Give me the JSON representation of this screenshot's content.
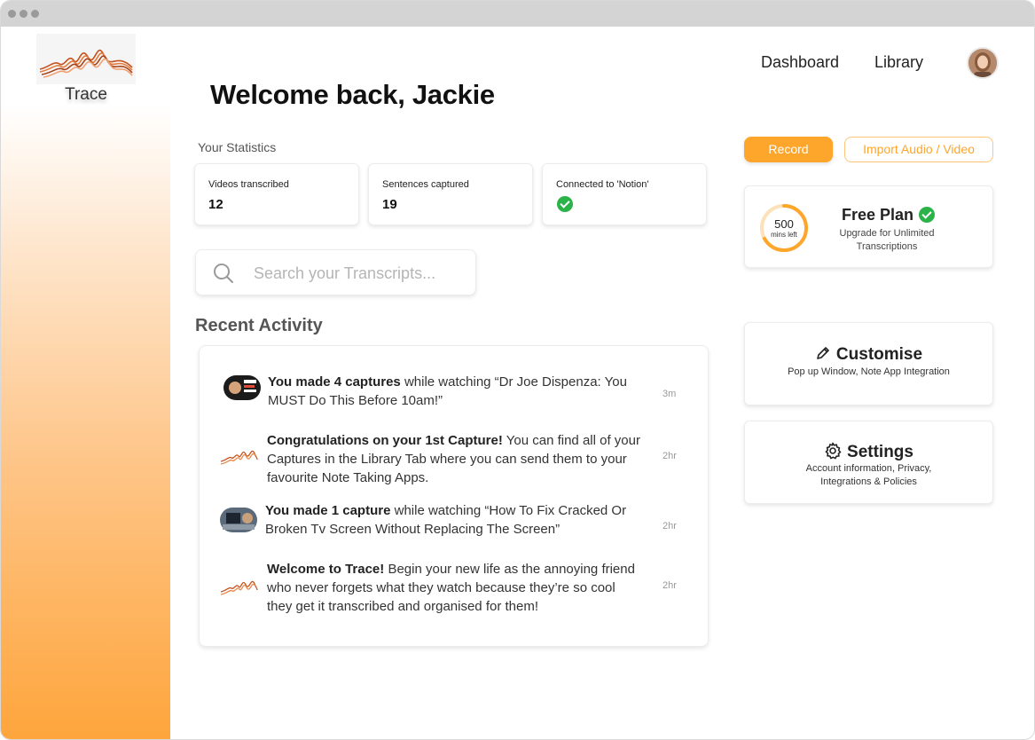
{
  "app": {
    "name": "Trace"
  },
  "nav": {
    "dashboard": "Dashboard",
    "library": "Library"
  },
  "header": {
    "welcome": "Welcome back, Jackie"
  },
  "statistics": {
    "label": "Your Statistics",
    "cards": [
      {
        "label": "Videos transcribed",
        "value": "12"
      },
      {
        "label": "Sentences captured",
        "value": "19"
      },
      {
        "label": "Connected to 'Notion'",
        "status": "connected"
      }
    ]
  },
  "search": {
    "placeholder": "Search your Transcripts..."
  },
  "recent": {
    "title": "Recent Activity",
    "items": [
      {
        "bold": "You made 4 captures",
        "line1_rest": " while watching “Dr Joe Dispenza: You",
        "line2": "MUST Do This Before 10am!”",
        "time": "3m"
      },
      {
        "bold": "Congratulations on your 1st Capture!",
        "line1_rest": " You can find all of your",
        "line2": "Captures in the Library Tab where you can send them to your",
        "line3": "favourite Note Taking Apps.",
        "time": "2hr"
      },
      {
        "bold": "You made 1 capture",
        "line1_rest": " while watching “How To Fix Cracked Or",
        "line2": "Broken Tv Screen Without Replacing The Screen”",
        "time": "2hr"
      },
      {
        "bold": "Welcome to Trace!",
        "line1_rest": " Begin your new life as the annoying friend",
        "line2": "who never forgets what they watch because they’re so cool",
        "line3": "they get it transcribed and organised for them!",
        "time": "2hr"
      }
    ]
  },
  "actions": {
    "record": "Record",
    "import": "Import Audio / Video"
  },
  "plan": {
    "minutes": "500",
    "minutes_label": "mins left",
    "minutes_fraction": 0.67,
    "title": "Free Plan",
    "subtitle_line1": "Upgrade for Unlimited",
    "subtitle_line2": "Transcriptions"
  },
  "customise": {
    "title": "Customise",
    "subtitle": "Pop up Window, Note App Integration"
  },
  "settings": {
    "title": "Settings",
    "subtitle_line1": "Account information, Privacy,",
    "subtitle_line2": "Integrations & Policies"
  },
  "colors": {
    "accent": "#fea62b",
    "success": "#2bb34a"
  }
}
